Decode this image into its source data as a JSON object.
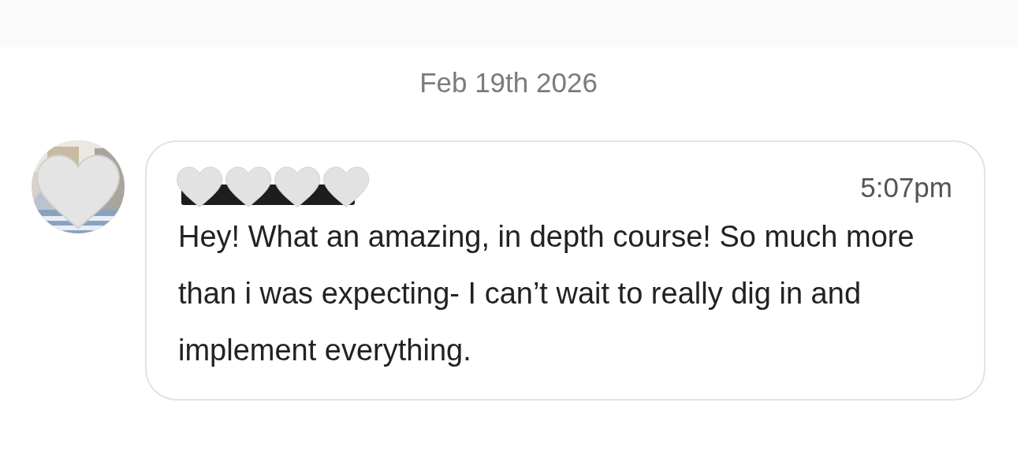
{
  "date_divider": "Feb 19th 2026",
  "message": {
    "time": "5:07pm",
    "text": "Hey! What an amazing, in depth course! So much more than i was expecting- I can’t wait to really dig in and implement everything."
  }
}
